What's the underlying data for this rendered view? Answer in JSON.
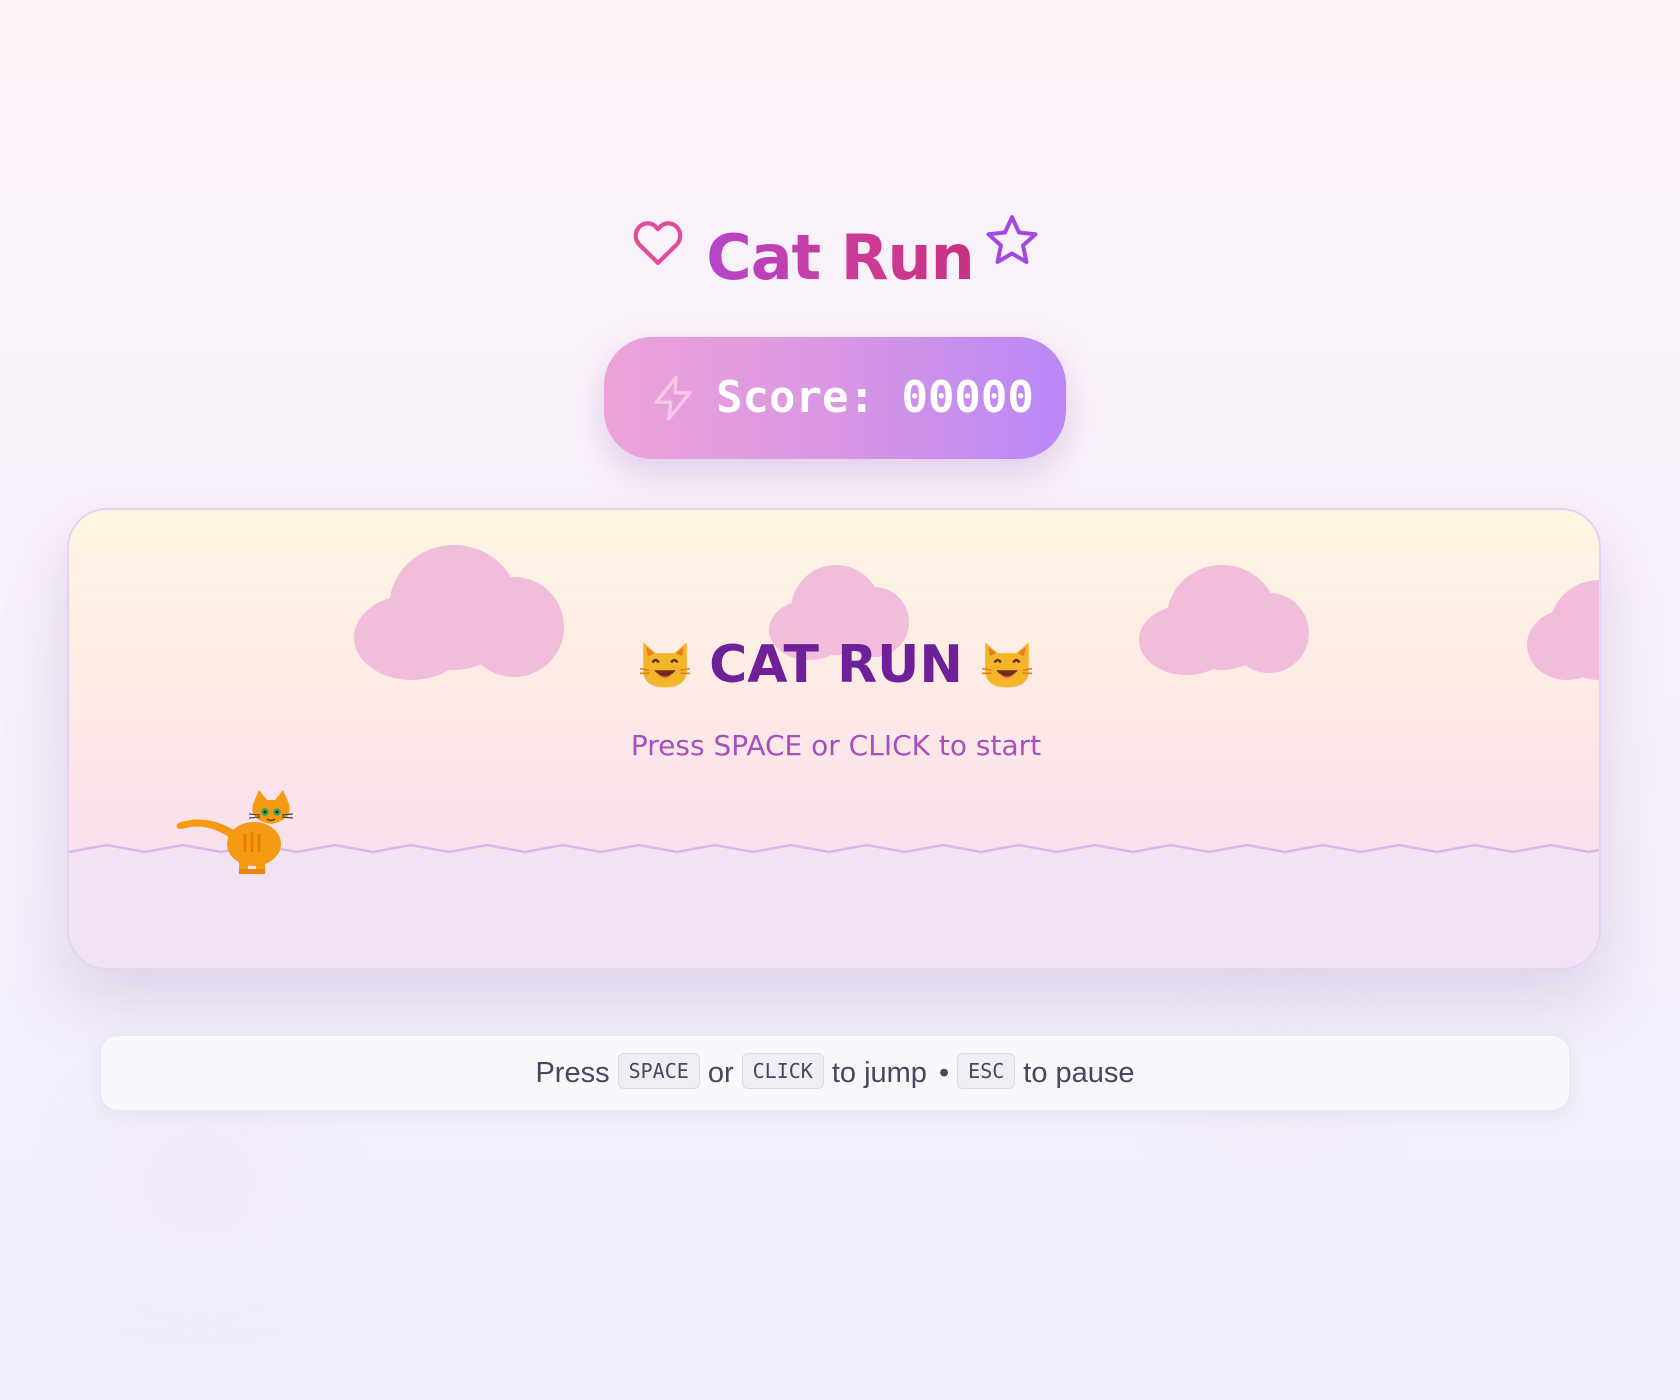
{
  "header": {
    "title": "Cat Run",
    "left_icon": "heart-outline-icon",
    "right_icon": "star-outline-icon"
  },
  "score": {
    "icon": "lightning-bolt-icon",
    "label": "Score:",
    "value": "00000"
  },
  "game": {
    "overlay_title": "CAT RUN",
    "overlay_subtitle": "Press SPACE or CLICK to start",
    "title_emoji_icon": "grinning-cat-face-icon",
    "player_icon": "orange-cat-sprite-icon"
  },
  "instructions": {
    "press": "Press",
    "key_space": "SPACE",
    "or": "or",
    "key_click": "CLICK",
    "to_jump": "to jump",
    "bullet": "•",
    "key_esc": "ESC",
    "to_pause": "to pause"
  },
  "colors": {
    "title_gradient_start": "#b545cf",
    "title_gradient_end": "#c7307f",
    "score_gradient_start": "#eca3d9",
    "score_gradient_end": "#b987f7",
    "overlay_title": "#6d2098",
    "overlay_subtitle": "#a84fbf",
    "cloud": "#f2bcdb",
    "cat": "#f59a12"
  }
}
